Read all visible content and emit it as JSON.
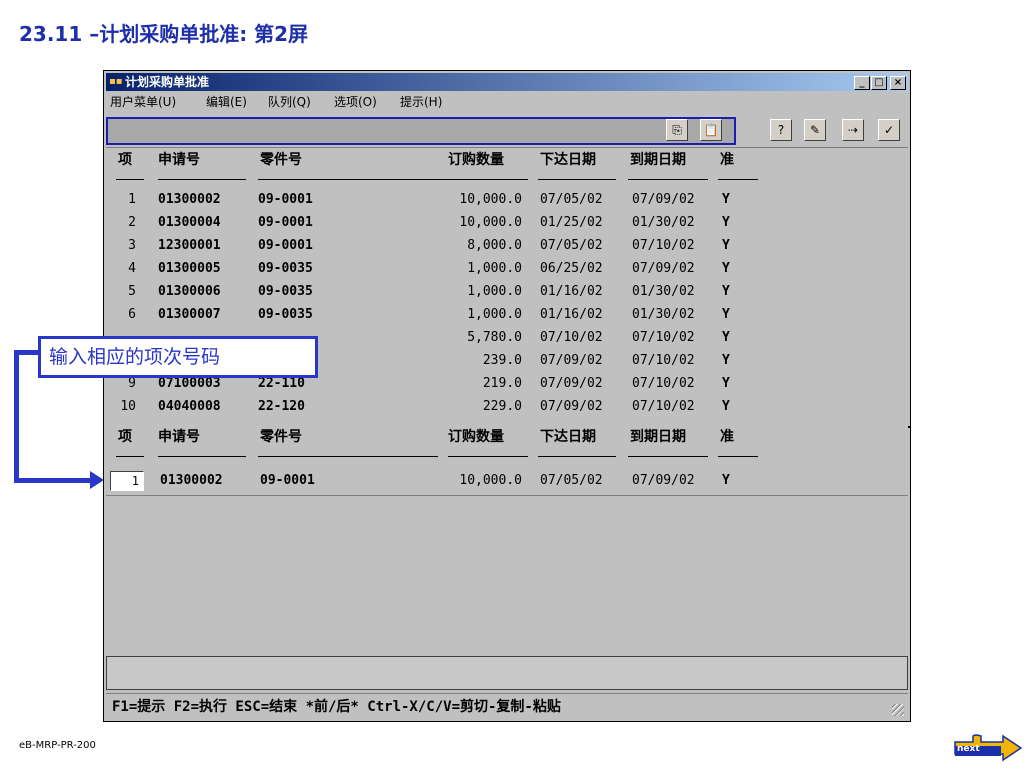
{
  "slide": {
    "title": "23.11 –计划采购单批准: 第2屏",
    "footer_code": "eB-MRP-PR-200",
    "next_label": "next",
    "callout_text": "输入相应的项次号码"
  },
  "window": {
    "title": "计划采购单批准",
    "min_label": "_",
    "max_label": "□",
    "close_label": "×"
  },
  "menu": {
    "items": [
      "用户菜单(U)",
      "编辑(E)",
      "队列(Q)",
      "选项(O)",
      "提示(H)"
    ]
  },
  "toolbar": {
    "copy_icon": "copy-icon",
    "paste_icon": "paste-icon",
    "tools": [
      "help-query-icon",
      "edit-query-icon",
      "export-icon",
      "exit-icon"
    ]
  },
  "columns": [
    "项",
    "申请号",
    "零件号",
    "订购数量",
    "下达日期",
    "到期日期",
    "准"
  ],
  "rows": [
    {
      "item": "1",
      "req": "01300002",
      "part": "09-0001",
      "qty": "10,000.0",
      "release": "07/05/02",
      "due": "07/09/02",
      "ok": "Y"
    },
    {
      "item": "2",
      "req": "01300004",
      "part": "09-0001",
      "qty": "10,000.0",
      "release": "01/25/02",
      "due": "01/30/02",
      "ok": "Y"
    },
    {
      "item": "3",
      "req": "12300001",
      "part": "09-0001",
      "qty": "8,000.0",
      "release": "07/05/02",
      "due": "07/10/02",
      "ok": "Y"
    },
    {
      "item": "4",
      "req": "01300005",
      "part": "09-0035",
      "qty": "1,000.0",
      "release": "06/25/02",
      "due": "07/09/02",
      "ok": "Y"
    },
    {
      "item": "5",
      "req": "01300006",
      "part": "09-0035",
      "qty": "1,000.0",
      "release": "01/16/02",
      "due": "01/30/02",
      "ok": "Y"
    },
    {
      "item": "6",
      "req": "01300007",
      "part": "09-0035",
      "qty": "1,000.0",
      "release": "01/16/02",
      "due": "01/30/02",
      "ok": "Y"
    },
    {
      "item": "",
      "req": "",
      "part": "",
      "qty": "5,780.0",
      "release": "07/10/02",
      "due": "07/10/02",
      "ok": "Y"
    },
    {
      "item": "",
      "req": "",
      "part": "",
      "qty": "239.0",
      "release": "07/09/02",
      "due": "07/10/02",
      "ok": "Y"
    },
    {
      "item": "9",
      "req": "07100003",
      "part": "22-110",
      "qty": "219.0",
      "release": "07/09/02",
      "due": "07/10/02",
      "ok": "Y"
    },
    {
      "item": "10",
      "req": "04040008",
      "part": "22-120",
      "qty": "229.0",
      "release": "07/09/02",
      "due": "07/10/02",
      "ok": "Y"
    }
  ],
  "detail": {
    "item": "1",
    "req": "01300002",
    "part": "09-0001",
    "qty": "10,000.0",
    "release": "07/05/02",
    "due": "07/09/02",
    "ok": "Y"
  },
  "status_text": "F1=提示 F2=执行 ESC=结束 *前/后* Ctrl-X/C/V=剪切-复制-粘贴",
  "colors": {
    "accent": "#2a35c9",
    "title_blue": "#1f2fa8",
    "window_bg": "#c0c0c0"
  }
}
